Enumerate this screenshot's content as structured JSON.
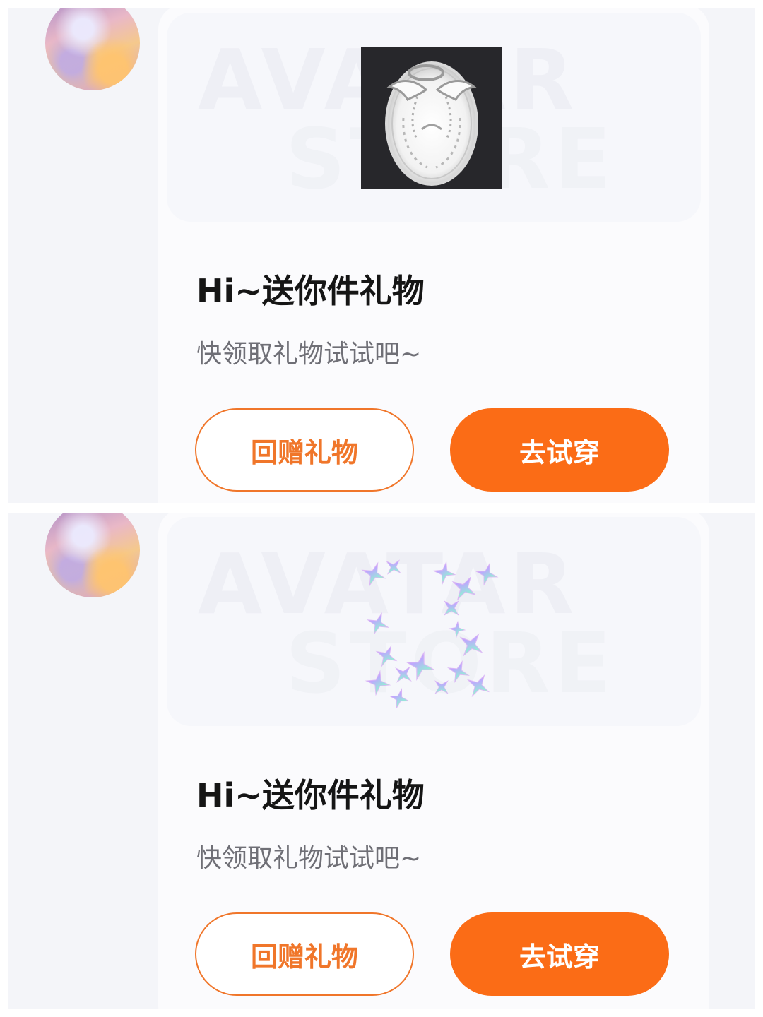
{
  "colors": {
    "accent": "#fb6c16",
    "accent_outline": "#f0762a",
    "panel_background": "#f4f5f9",
    "card_background": "#fbfbfd"
  },
  "messages": [
    {
      "avatar_icon": "anime-girl-avatar",
      "banner": {
        "watermark_line1": "AVATAR",
        "watermark_line2": "STORE"
      },
      "gift_image_icon": "angel-wings-halo-icon",
      "title": "Hi~送你件礼物",
      "subtitle": "快领取礼物试试吧~",
      "return_gift_label": "回赠礼物",
      "try_on_label": "去试穿"
    },
    {
      "avatar_icon": "anime-girl-avatar",
      "banner": {
        "watermark_line1": "AVATAR",
        "watermark_line2": "STORE"
      },
      "gift_image_icon": "sparkle-stars-icon",
      "title": "Hi~送你件礼物",
      "subtitle": "快领取礼物试试吧~",
      "return_gift_label": "回赠礼物",
      "try_on_label": "去试穿"
    }
  ]
}
